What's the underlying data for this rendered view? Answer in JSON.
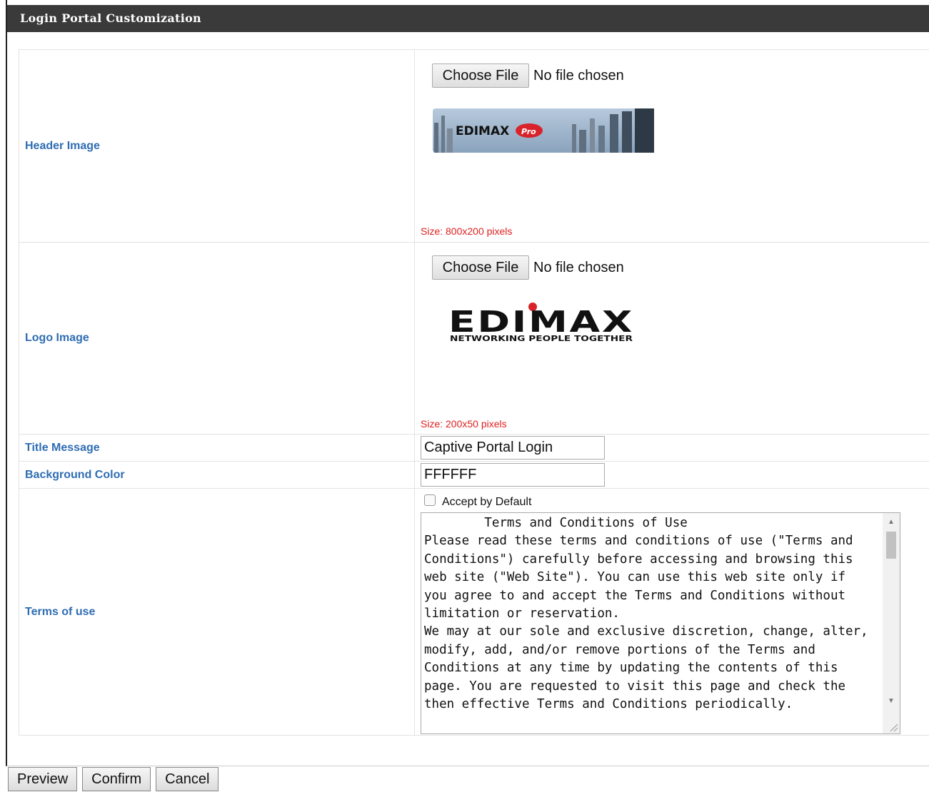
{
  "panel": {
    "title": "Login Portal Customization"
  },
  "rows": {
    "header_image": {
      "label": "Header Image",
      "choose_file": "Choose File",
      "file_status": "No file chosen",
      "logo_text": "EDIMAX",
      "logo_badge": "Pro",
      "size_note": "Size: 800x200 pixels"
    },
    "logo_image": {
      "label": "Logo Image",
      "choose_file": "Choose File",
      "file_status": "No file chosen",
      "logo_text": "EDIMAX",
      "logo_tagline": "NETWORKING PEOPLE TOGETHER",
      "size_note": "Size: 200x50 pixels"
    },
    "title_message": {
      "label": "Title Message",
      "value": "Captive Portal Login"
    },
    "background_color": {
      "label": "Background Color",
      "value": "FFFFFF"
    },
    "terms": {
      "label": "Terms of use",
      "accept_label": "Accept by Default",
      "accept_checked": false,
      "text": "        Terms and Conditions of Use\nPlease read these terms and conditions of use (\"Terms and Conditions\") carefully before accessing and browsing this web site (\"Web Site\"). You can use this web site only if you agree to and accept the Terms and Conditions without limitation or reservation.\nWe may at our sole and exclusive discretion, change, alter, modify, add, and/or remove portions of the Terms and Conditions at any time by updating the contents of this page. You are requested to visit this page and check the then effective Terms and Conditions periodically."
    }
  },
  "actions": {
    "preview": "Preview",
    "confirm": "Confirm",
    "cancel": "Cancel"
  },
  "colors": {
    "label_blue": "#2f6db3",
    "size_note_red": "#e02020",
    "title_bar": "#3a3a3a"
  }
}
